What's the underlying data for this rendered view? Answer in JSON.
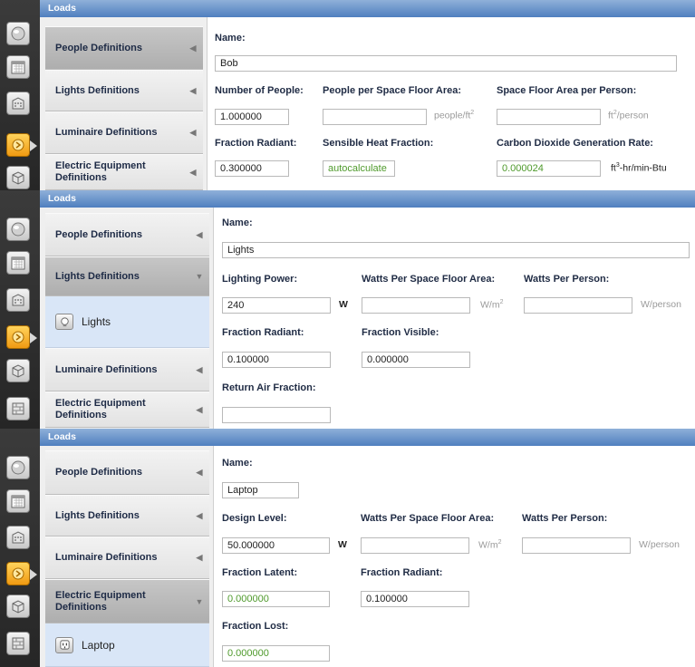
{
  "header": "Loads",
  "nav": {
    "people": "People Definitions",
    "lights": "Lights Definitions",
    "luminaire": "Luminaire Definitions",
    "electric": "Electric Equipment Definitions"
  },
  "icons": [
    "sphere-icon",
    "calendar-icon",
    "building-icon",
    "loads-icon",
    "box-icon",
    "construction-icon"
  ],
  "colors": {
    "header": "#5a88c6",
    "accent_green": "#4f9a2c",
    "active_icon": "#f5a623",
    "selected_item": "#b8b8b8",
    "subitem_bg": "#d9e6f7"
  },
  "panel1": {
    "name_label": "Name:",
    "name_value": "Bob",
    "num_people_label": "Number of People:",
    "num_people_value": "1.000000",
    "ppl_per_area_label": "People per Space Floor Area:",
    "ppl_per_area_value": "",
    "ppl_per_area_unit": "people/ft",
    "area_per_person_label": "Space Floor Area per Person:",
    "area_per_person_value": "",
    "area_per_person_unit_a": "ft",
    "area_per_person_unit_b": "/person",
    "fraction_radiant_label": "Fraction Radiant:",
    "fraction_radiant_value": "0.300000",
    "sensible_label": "Sensible Heat Fraction:",
    "sensible_value": "autocalculate",
    "co2_label": "Carbon Dioxide Generation Rate:",
    "co2_value": "0.000024",
    "co2_unit_a": "ft",
    "co2_unit_b": "-hr/min-Btu",
    "sup2": "2",
    "sup3": "3"
  },
  "panel2": {
    "sub_item": "Lights",
    "name_label": "Name:",
    "name_value": "Lights",
    "power_label": "Lighting Power:",
    "power_value": "240",
    "power_unit": "W",
    "watts_area_label": "Watts Per Space Floor Area:",
    "watts_area_value": "",
    "watts_area_unit": "W/m",
    "watts_person_label": "Watts Per Person:",
    "watts_person_value": "",
    "watts_person_unit": "W/person",
    "fraction_radiant_label": "Fraction Radiant:",
    "fraction_radiant_value": "0.100000",
    "fraction_visible_label": "Fraction Visible:",
    "fraction_visible_value": "0.000000",
    "return_air_label": "Return Air Fraction:",
    "return_air_value": "",
    "sup2": "2"
  },
  "panel3": {
    "sub_item": "Laptop",
    "name_label": "Name:",
    "name_value": "Laptop",
    "design_label": "Design Level:",
    "design_value": "50.000000",
    "design_unit": "W",
    "watts_area_label": "Watts Per Space Floor Area:",
    "watts_area_value": "",
    "watts_area_unit": "W/m",
    "watts_person_label": "Watts Per Person:",
    "watts_person_value": "",
    "watts_person_unit": "W/person",
    "fraction_latent_label": "Fraction Latent:",
    "fraction_latent_value": "0.000000",
    "fraction_radiant_label": "Fraction Radiant:",
    "fraction_radiant_value": "0.100000",
    "fraction_lost_label": "Fraction Lost:",
    "fraction_lost_value": "0.000000",
    "sup2": "2"
  }
}
